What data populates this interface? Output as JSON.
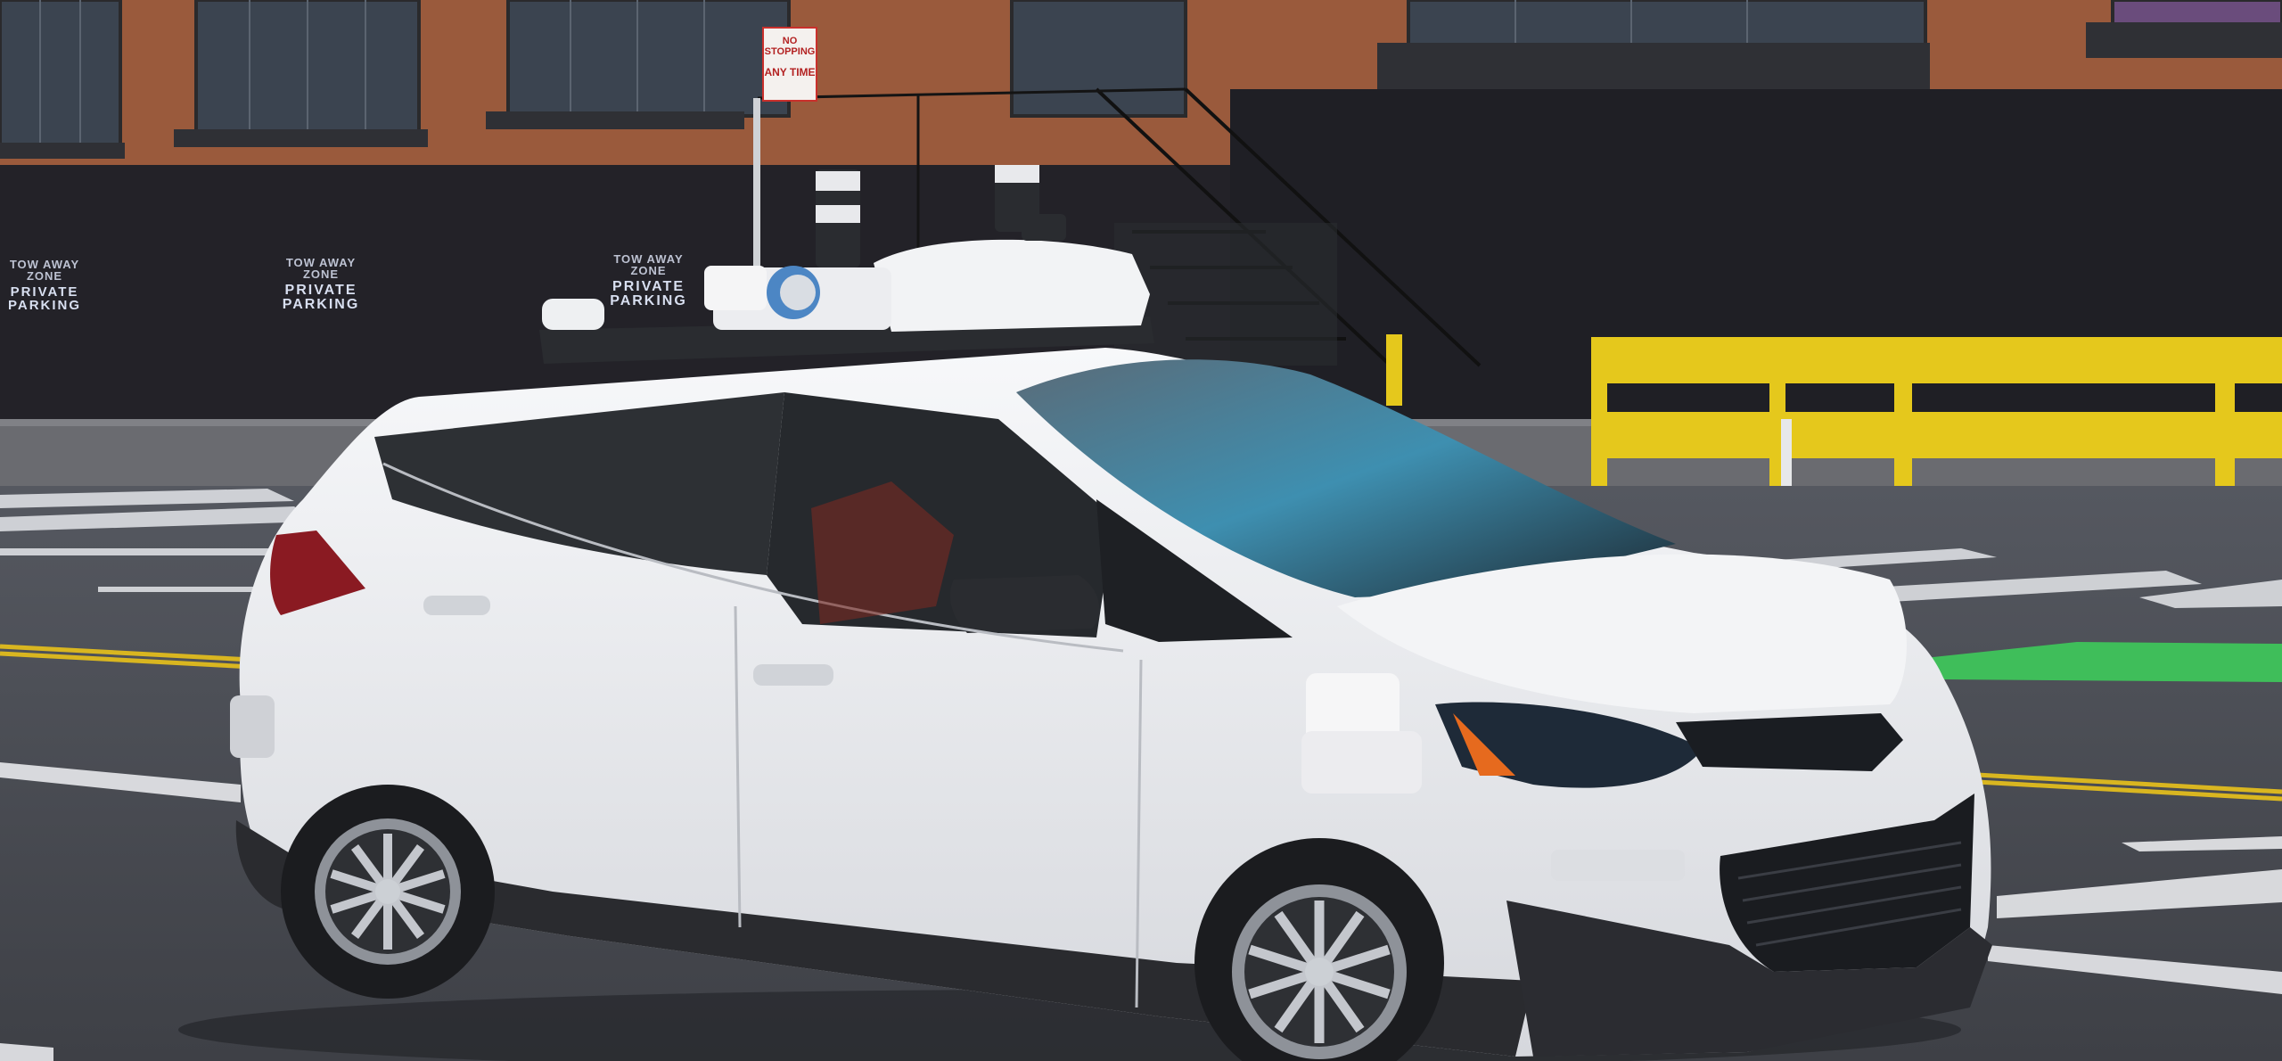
{
  "scene": {
    "wall_signs": [
      {
        "small": "TOW AWAY ZONE",
        "big": "PRIVATE PARKING"
      },
      {
        "small": "TOW AWAY ZONE",
        "big": "PRIVATE PARKING"
      },
      {
        "small": "TOW AWAY ZONE",
        "big": "PRIVATE PARKING"
      }
    ],
    "street_sign": {
      "line1": "NO STOPPING",
      "line2": "ANY TIME"
    },
    "colors": {
      "sky_shadow": "#2b2a2e",
      "brick": "#9a5a3c",
      "wall_dark": "#232228",
      "road": "#4a4c52",
      "car_body": "#eeeff2",
      "rail_yellow": "#e5c81c",
      "bike_lane": "#3fbe5a"
    }
  }
}
